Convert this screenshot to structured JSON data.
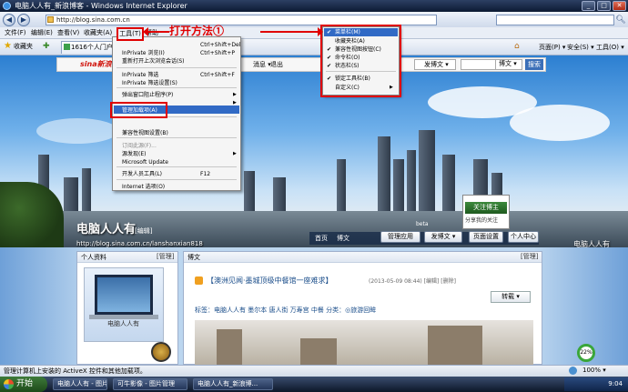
{
  "window": {
    "title": "电脑人人有_新浪博客 - Windows Internet Explorer",
    "min": "_",
    "max": "□",
    "close": "✕"
  },
  "address": {
    "url": "http://blog.sina.com.cn",
    "back": "◀",
    "forward": "▶"
  },
  "menubar": {
    "file": "文件(F)",
    "edit": "编辑(E)",
    "view": "查看(V)",
    "favorites": "收藏夹(A)",
    "help": "帮助"
  },
  "favbar": {
    "favorites": "收藏夹",
    "tab_label": "1616个人门户_3"
  },
  "commandbar": {
    "page": "页面(P) ▾",
    "safety": "安全(S) ▾",
    "tools": "工具(O) ▾"
  },
  "tools_menu": {
    "label": "工具(T)",
    "items": [
      {
        "label": "",
        "shortcut": "Ctrl+Shift+Del"
      },
      {
        "label": "InPrivate 浏览(I)",
        "shortcut": "Ctrl+Shift+P"
      },
      {
        "label": "重新打开上次浏览会话(S)",
        "shortcut": ""
      },
      {
        "label": "InPrivate 筛选",
        "shortcut": "Ctrl+Shift+F"
      },
      {
        "label": "InPrivate 筛选设置(S)",
        "shortcut": ""
      },
      {
        "label": "弹出窗口阻止程序(P)",
        "shortcut": "",
        "arrow": "▶"
      },
      {
        "label": "",
        "shortcut": "",
        "arrow": "▶"
      },
      {
        "label": "管理加载项(A)",
        "shortcut": ""
      },
      {
        "label": "",
        "shortcut": ""
      },
      {
        "label": "兼容性视图设置(B)",
        "shortcut": ""
      },
      {
        "label": "订阅此源(F)...",
        "shortcut": ""
      },
      {
        "label": "源发现(E)",
        "shortcut": "",
        "arrow": "▶"
      },
      {
        "label": "Microsoft Update",
        "shortcut": ""
      },
      {
        "label": "开发人员工具(L)",
        "shortcut": "F12"
      },
      {
        "label": "Internet 选项(O)",
        "shortcut": ""
      }
    ]
  },
  "toolbars_menu": {
    "items": [
      {
        "label": "菜单栏(M)",
        "checked": "✔"
      },
      {
        "label": "收藏夹栏(A)",
        "checked": ""
      },
      {
        "label": "兼容性视图按钮(C)",
        "checked": "✔"
      },
      {
        "label": "命令栏(O)",
        "checked": "✔"
      },
      {
        "label": "状态栏(S)",
        "checked": "✔"
      },
      {
        "label": "锁定工具栏(B)",
        "checked": "✔"
      },
      {
        "label": "自定义(C)",
        "checked": "",
        "arrow": "▶"
      }
    ]
  },
  "annotation": {
    "text": "打开方法①"
  },
  "sina_bar": {
    "logo": "sina新浪",
    "messages": "消息 ▾",
    "logout": "退出",
    "post": "发博文 ▾",
    "search_scope": "博文 ▾",
    "search_btn": "搜索"
  },
  "blog": {
    "title": "电脑人人有",
    "edit": "[编辑]",
    "url": "http://blog.sina.com.cn/lanshanxian818",
    "watermark": "电脑人人有",
    "beta": "beta",
    "nav_home": "首页",
    "nav_articles": "博文",
    "manage_btn": "管理应用",
    "post_btn": "发博文 ▾",
    "page_settings_btn": "页面设置",
    "user_center_btn": "个人中心",
    "follow_btn": "关注博主",
    "follow_sub": "分享我的关注"
  },
  "profile": {
    "header": "个人资料",
    "manage": "[管理]",
    "avatar_caption": "电脑人人有"
  },
  "article": {
    "header": "博文",
    "manage": "[管理]",
    "title": "【澳洲见闻·墨城顶级中餐馆一座难求】",
    "meta": "(2013-05-09 08:44) [编辑] [删除]",
    "repost": "转载 ▾",
    "tags": "标签：电脑人人有 墨尔本 唐人街 万寿宫 中餐  分类：◎旅游回眸"
  },
  "zoom_gauge": "22%",
  "statusbar": {
    "text": "管理计算机上安装的 ActiveX 控件和其他加载项。",
    "zoom": "100% ▾"
  },
  "taskbar": {
    "start": "开始",
    "items": [
      "电脑人人有 - 图片...",
      "可牛影像 - 图片管理",
      "电脑人人有_新浪博..."
    ],
    "clock": "9:04"
  }
}
